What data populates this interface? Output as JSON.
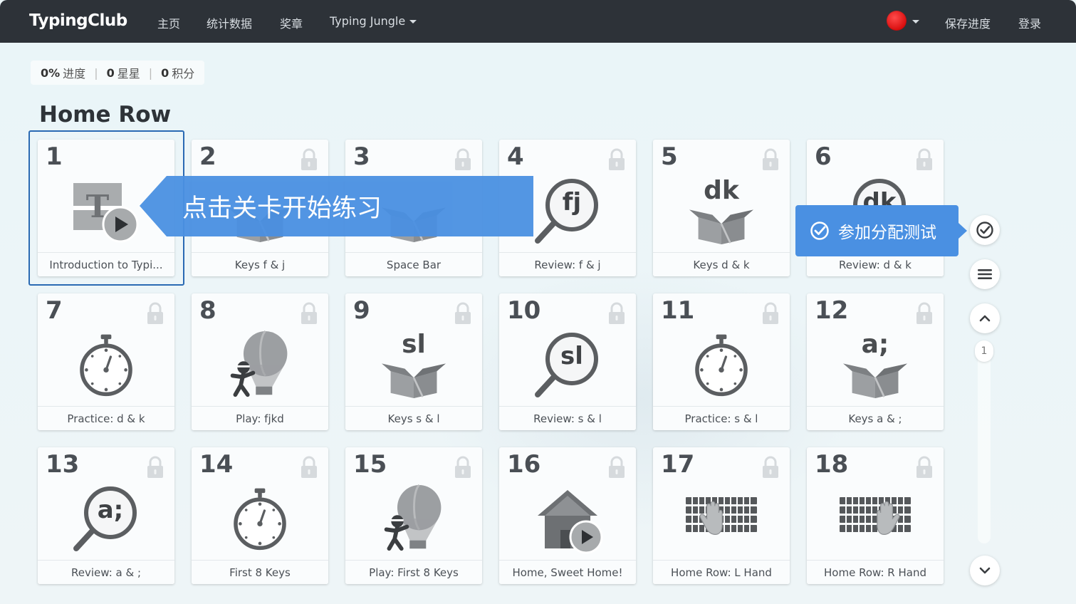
{
  "navbar": {
    "brand": "TypingClub",
    "links": [
      "主页",
      "统计数据",
      "奖章",
      "Typing Jungle"
    ],
    "save_progress": "保存进度",
    "login": "登录"
  },
  "stats": {
    "progress_value": "0%",
    "progress_label": "进度",
    "stars_value": "0",
    "stars_label": "星星",
    "points_value": "0",
    "points_label": "积分"
  },
  "section_title": "Home Row",
  "tiles": [
    {
      "num": "1",
      "label": "Introduction to Typi...",
      "icon": "typewriter-play-icon",
      "locked": false
    },
    {
      "num": "2",
      "label": "Keys f & j",
      "icon": "box-icon",
      "locked": true
    },
    {
      "num": "3",
      "label": "Space Bar",
      "icon": "box-icon",
      "locked": true
    },
    {
      "num": "4",
      "label": "Review: f & j",
      "icon": "magnifier-icon",
      "icon_text": "fj",
      "locked": true
    },
    {
      "num": "5",
      "label": "Keys d & k",
      "icon": "box-icon",
      "icon_text": "dk",
      "locked": true
    },
    {
      "num": "6",
      "label": "Review: d & k",
      "icon": "magnifier-icon",
      "icon_text": "dk",
      "locked": true
    },
    {
      "num": "7",
      "label": "Practice: d & k",
      "icon": "stopwatch-icon",
      "locked": true
    },
    {
      "num": "8",
      "label": "Play: fjkd",
      "icon": "balloon-ninja-icon",
      "locked": true
    },
    {
      "num": "9",
      "label": "Keys s & l",
      "icon": "box-icon",
      "icon_text": "sl",
      "locked": true
    },
    {
      "num": "10",
      "label": "Review: s & l",
      "icon": "magnifier-icon",
      "icon_text": "sl",
      "locked": true
    },
    {
      "num": "11",
      "label": "Practice: s & l",
      "icon": "stopwatch-icon",
      "locked": true
    },
    {
      "num": "12",
      "label": "Keys a & ;",
      "icon": "box-icon",
      "icon_text": "a;",
      "locked": true
    },
    {
      "num": "13",
      "label": "Review: a & ;",
      "icon": "magnifier-icon",
      "icon_text": "a;",
      "locked": true
    },
    {
      "num": "14",
      "label": "First 8 Keys",
      "icon": "stopwatch-icon",
      "locked": true
    },
    {
      "num": "15",
      "label": "Play: First 8 Keys",
      "icon": "balloon-ninja-icon",
      "locked": true
    },
    {
      "num": "16",
      "label": "Home, Sweet Home!",
      "icon": "house-play-icon",
      "locked": true
    },
    {
      "num": "17",
      "label": "Home Row: L Hand",
      "icon": "keyboard-left-hand-icon",
      "locked": true
    },
    {
      "num": "18",
      "label": "Home Row: R Hand",
      "icon": "keyboard-right-hand-icon",
      "locked": true
    }
  ],
  "callout_main": "点击关卡开始练习",
  "callout_test": "参加分配测试",
  "pager": {
    "current_page": "1"
  },
  "colors": {
    "nav_bg": "#2d3238",
    "accent": "#4a90e2",
    "selected_border": "#2a6ab3"
  }
}
